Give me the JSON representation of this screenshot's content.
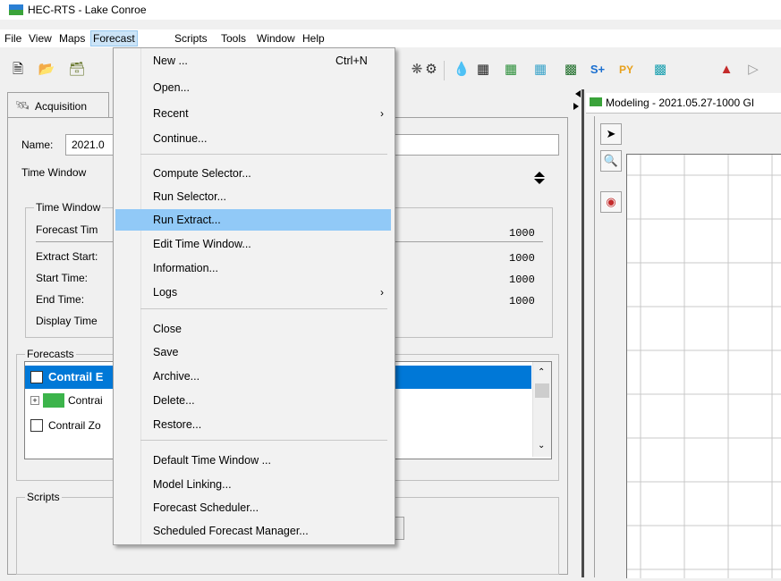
{
  "window": {
    "title": "HEC-RTS - Lake Conroe"
  },
  "menubar": {
    "items": [
      "File",
      "View",
      "Maps",
      "Forecast",
      "Scripts",
      "Tools",
      "Window",
      "Help"
    ],
    "active": "Forecast"
  },
  "toolbar": {
    "s_plus_label": "S+",
    "py_label": "PY"
  },
  "left": {
    "tab_label": "Acquisition",
    "name_label": "Name:",
    "name_value": "2021.0",
    "time_window_label": "Time Window",
    "group_time_window": "Time Window",
    "forecast_time_label": "Forecast Tim",
    "extract_start_label": "Extract Start:",
    "start_time_label": "Start Time:",
    "end_time_label": "End Time:",
    "display_time_label": "Display Time",
    "val_forecast": "1000",
    "val_extract": "1000",
    "val_start": "1000",
    "val_end": "1000",
    "forecasts_title": "Forecasts",
    "forecast_rows": [
      "Contrail E",
      "Contrai",
      "Contrail Zo"
    ],
    "scripts_title": "Scripts"
  },
  "right": {
    "title": "Modeling - 2021.05.27-1000 GI"
  },
  "dropdown": {
    "items": [
      {
        "label": "New ...",
        "shortcut": "Ctrl+N"
      },
      {
        "label": "Open..."
      },
      {
        "label": "Recent",
        "arrow": "›"
      },
      {
        "label": "Continue..."
      },
      {
        "label": "Compute Selector..."
      },
      {
        "label": "Run Selector..."
      },
      {
        "label": "Run Extract..."
      },
      {
        "label": "Edit Time Window..."
      },
      {
        "label": "Information..."
      },
      {
        "label": "Logs",
        "arrow": "›"
      },
      {
        "label": "Close"
      },
      {
        "label": "Save"
      },
      {
        "label": "Archive..."
      },
      {
        "label": "Delete..."
      },
      {
        "label": "Restore..."
      },
      {
        "label": "Default Time Window ..."
      },
      {
        "label": "Model Linking..."
      },
      {
        "label": "Forecast Scheduler..."
      },
      {
        "label": "Scheduled Forecast Manager..."
      }
    ],
    "highlighted": "Run Extract..."
  },
  "colors": {
    "highlight": "#91c9f7",
    "selection": "#0078d7",
    "menu_active": "#cce4f7"
  }
}
